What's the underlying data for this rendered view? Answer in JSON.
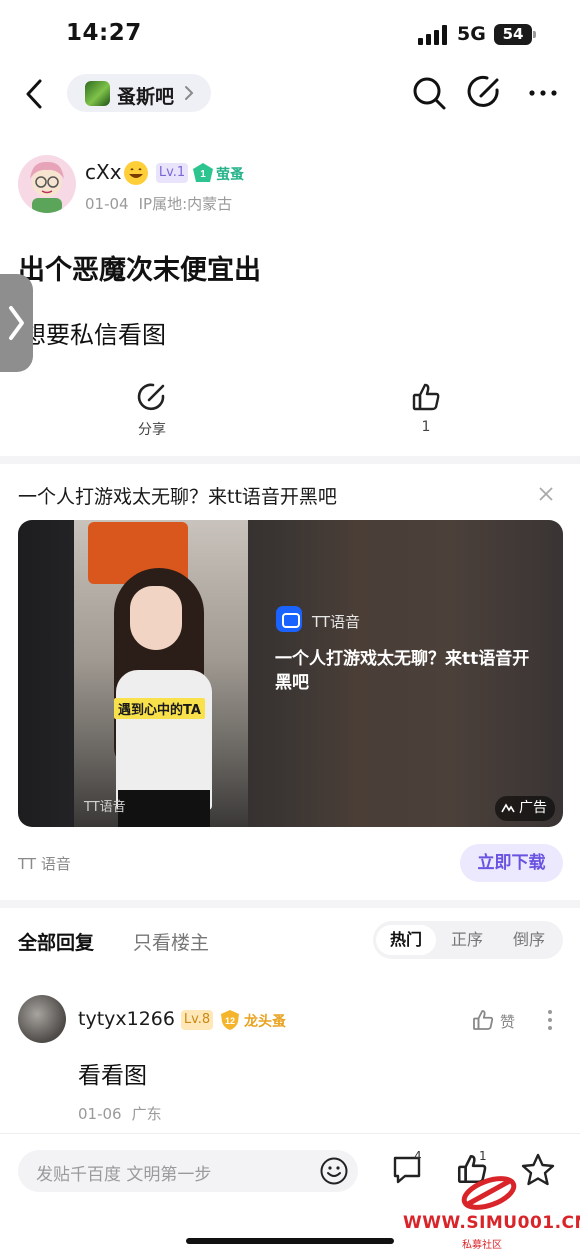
{
  "status_bar": {
    "time": "14:27",
    "network": "5G",
    "battery": "54"
  },
  "nav": {
    "forum_name": "蚤斯吧"
  },
  "post": {
    "author": "cXx",
    "level": "Lv.1",
    "badge_num": "1",
    "badge_label": "萤蚤",
    "date": "01-04",
    "ip": "IP属地:内蒙古",
    "title": "出个恶魔次末便宜出",
    "body": "想要私信看图",
    "share_label": "分享",
    "like_count": "1"
  },
  "ad": {
    "headline": "一个人打游戏太无聊？来tt语音开黑吧",
    "caption": "遇到心中的TA",
    "watermark": "TT语音",
    "brand": "TT语音",
    "description": "一个人打游戏太无聊？来tt语音开黑吧",
    "tag": "广告",
    "advertiser": "TT 语音",
    "cta": "立即下载"
  },
  "replies_header": {
    "tab_all": "全部回复",
    "tab_op": "只看楼主",
    "sort_hot": "热门",
    "sort_asc": "正序",
    "sort_desc": "倒序"
  },
  "reply": {
    "user": "tytyx1266",
    "level": "Lv.8",
    "badge_num": "12",
    "badge_label": "龙头蚤",
    "like_label": "赞",
    "text": "看看图",
    "date": "01-06",
    "location": "广东"
  },
  "bottom_bar": {
    "input_placeholder": "发贴千百度 文明第一步",
    "comment_count": "4",
    "like_count": "1"
  },
  "watermark": {
    "site": "WWW.SIMU001.CN",
    "sub": "私募社区"
  },
  "colors": {
    "accent": "#6a53e0",
    "level_purple": "#7a68d8",
    "gem_green": "#26b38a",
    "gold": "#e8a321",
    "watermark_red": "#d9252a"
  }
}
